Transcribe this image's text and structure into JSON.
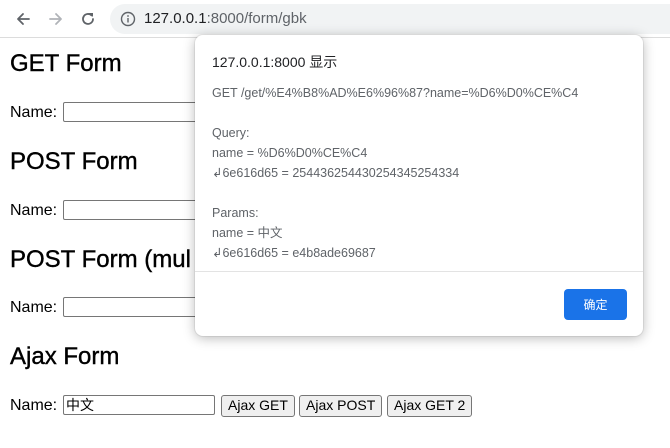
{
  "browser": {
    "back_icon": "arrow-left-icon",
    "forward_icon": "arrow-right-icon",
    "reload_icon": "reload-icon",
    "site_info_icon": "info-icon",
    "url_host": "127.0.0.1",
    "url_rest": ":8000/form/gbk"
  },
  "forms": [
    {
      "title": "GET Form",
      "name_label": "Name:",
      "input_value": ""
    },
    {
      "title": "POST Form",
      "name_label": "Name:",
      "input_value": ""
    },
    {
      "title": "POST Form (mul",
      "name_label": "Name:",
      "input_value": ""
    },
    {
      "title": "Ajax Form",
      "name_label": "Name:",
      "input_value": "中文",
      "buttons": [
        "Ajax GET",
        "Ajax POST",
        "Ajax GET 2"
      ]
    }
  ],
  "dialog": {
    "title": "127.0.0.1:8000 显示",
    "lines": [
      "GET /get/%E4%B8%AD%E6%96%87?name=%D6%D0%CE%C4",
      "",
      "Query:",
      "name = %D6%D0%CE%C4",
      "↲6e616d65 = 254436254430254345254334",
      "",
      "Params:",
      "name = 中文",
      "↲6e616d65 = e4b8ade69687"
    ],
    "ok_label": "确定",
    "accent": "#1a73e8"
  }
}
